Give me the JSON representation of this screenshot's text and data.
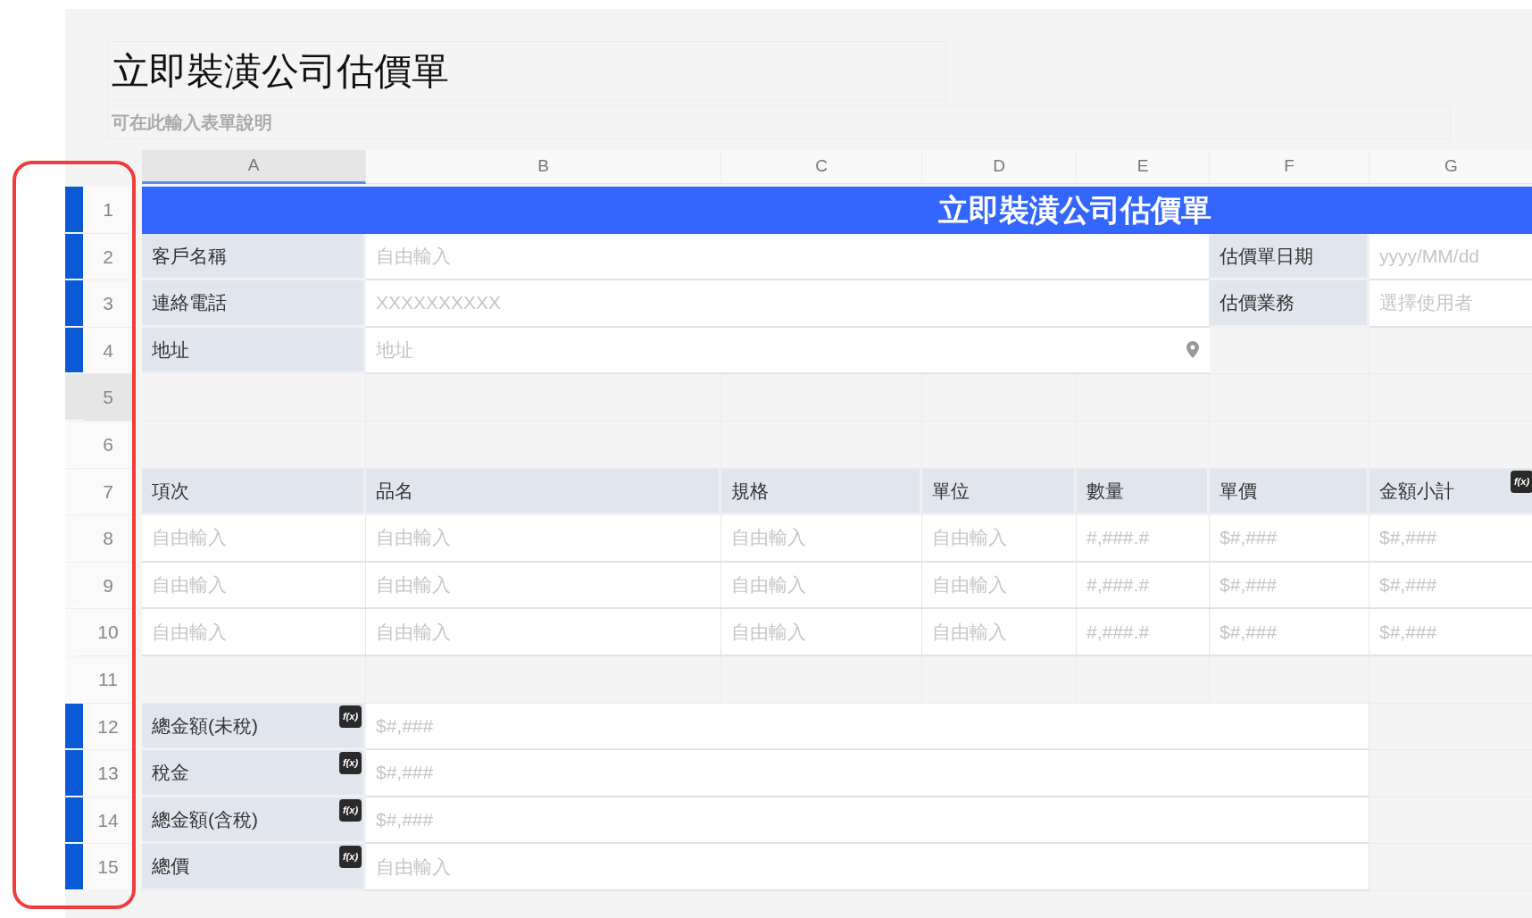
{
  "form_title": "立即裝潢公司估價單",
  "form_description": "可在此輸入表單說明",
  "row_header_highlight": true,
  "columns": [
    {
      "label": "A",
      "selected": true
    },
    {
      "label": "B",
      "selected": false
    },
    {
      "label": "C",
      "selected": false
    },
    {
      "label": "D",
      "selected": false
    },
    {
      "label": "E",
      "selected": false
    },
    {
      "label": "F",
      "selected": false
    },
    {
      "label": "G",
      "selected": false
    }
  ],
  "rows": [
    {
      "number": "1",
      "marked": true,
      "selected": false,
      "cells": [
        {
          "kind": "banner",
          "text": "立即裝潢公司估價單"
        },
        {
          "kind": "merged"
        },
        {
          "kind": "merged"
        },
        {
          "kind": "merged"
        },
        {
          "kind": "merged"
        },
        {
          "kind": "merged"
        },
        {
          "kind": "merged"
        }
      ]
    },
    {
      "number": "2",
      "marked": true,
      "selected": false,
      "cells": [
        {
          "kind": "label",
          "text": "客戶名稱"
        },
        {
          "kind": "input",
          "placeholder": "自由輸入"
        },
        {
          "kind": "merged"
        },
        {
          "kind": "merged"
        },
        {
          "kind": "merged"
        },
        {
          "kind": "label",
          "text": "估價單日期"
        },
        {
          "kind": "input",
          "placeholder": "yyyy/MM/dd"
        }
      ]
    },
    {
      "number": "3",
      "marked": true,
      "selected": false,
      "cells": [
        {
          "kind": "label",
          "text": "連絡電話"
        },
        {
          "kind": "input",
          "placeholder": "XXXXXXXXXX"
        },
        {
          "kind": "merged"
        },
        {
          "kind": "merged"
        },
        {
          "kind": "merged"
        },
        {
          "kind": "label",
          "text": "估價業務"
        },
        {
          "kind": "input",
          "placeholder": "選擇使用者"
        }
      ]
    },
    {
      "number": "4",
      "marked": true,
      "selected": false,
      "cells": [
        {
          "kind": "label",
          "text": "地址"
        },
        {
          "kind": "address",
          "placeholder": "地址"
        },
        {
          "kind": "merged"
        },
        {
          "kind": "merged"
        },
        {
          "kind": "merged"
        },
        {
          "kind": "blank"
        },
        {
          "kind": "blank"
        }
      ]
    },
    {
      "number": "5",
      "marked": false,
      "selected": true,
      "cells": [
        {
          "kind": "blank"
        },
        {
          "kind": "blank"
        },
        {
          "kind": "blank"
        },
        {
          "kind": "blank"
        },
        {
          "kind": "blank"
        },
        {
          "kind": "blank"
        },
        {
          "kind": "blank"
        }
      ]
    },
    {
      "number": "6",
      "marked": false,
      "selected": false,
      "cells": [
        {
          "kind": "blank"
        },
        {
          "kind": "blank"
        },
        {
          "kind": "blank"
        },
        {
          "kind": "blank"
        },
        {
          "kind": "blank"
        },
        {
          "kind": "blank"
        },
        {
          "kind": "blank"
        }
      ]
    },
    {
      "number": "7",
      "marked": false,
      "selected": false,
      "cells": [
        {
          "kind": "label",
          "text": "項次"
        },
        {
          "kind": "label",
          "text": "品名"
        },
        {
          "kind": "label",
          "text": "規格"
        },
        {
          "kind": "label",
          "text": "單位"
        },
        {
          "kind": "label",
          "text": "數量"
        },
        {
          "kind": "label",
          "text": "單價"
        },
        {
          "kind": "label",
          "text": "金額小計",
          "formula": "f(x)"
        }
      ]
    },
    {
      "number": "8",
      "marked": false,
      "selected": false,
      "cells": [
        {
          "kind": "input",
          "placeholder": "自由輸入"
        },
        {
          "kind": "input",
          "placeholder": "自由輸入"
        },
        {
          "kind": "input",
          "placeholder": "自由輸入"
        },
        {
          "kind": "input",
          "placeholder": "自由輸入"
        },
        {
          "kind": "input",
          "placeholder": "#,###.#"
        },
        {
          "kind": "input",
          "placeholder": "$#,###"
        },
        {
          "kind": "input",
          "placeholder": "$#,###"
        }
      ]
    },
    {
      "number": "9",
      "marked": false,
      "selected": false,
      "cells": [
        {
          "kind": "input",
          "placeholder": "自由輸入"
        },
        {
          "kind": "input",
          "placeholder": "自由輸入"
        },
        {
          "kind": "input",
          "placeholder": "自由輸入"
        },
        {
          "kind": "input",
          "placeholder": "自由輸入"
        },
        {
          "kind": "input",
          "placeholder": "#,###.#"
        },
        {
          "kind": "input",
          "placeholder": "$#,###"
        },
        {
          "kind": "input",
          "placeholder": "$#,###"
        }
      ]
    },
    {
      "number": "10",
      "marked": false,
      "selected": false,
      "cells": [
        {
          "kind": "input",
          "placeholder": "自由輸入"
        },
        {
          "kind": "input",
          "placeholder": "自由輸入"
        },
        {
          "kind": "input",
          "placeholder": "自由輸入"
        },
        {
          "kind": "input",
          "placeholder": "自由輸入"
        },
        {
          "kind": "input",
          "placeholder": "#,###.#"
        },
        {
          "kind": "input",
          "placeholder": "$#,###"
        },
        {
          "kind": "input",
          "placeholder": "$#,###"
        }
      ]
    },
    {
      "number": "11",
      "marked": false,
      "selected": false,
      "cells": [
        {
          "kind": "blank"
        },
        {
          "kind": "blank"
        },
        {
          "kind": "blank"
        },
        {
          "kind": "blank"
        },
        {
          "kind": "blank"
        },
        {
          "kind": "blank"
        },
        {
          "kind": "blank"
        }
      ]
    },
    {
      "number": "12",
      "marked": true,
      "selected": false,
      "cells": [
        {
          "kind": "label",
          "text": "總金額(未稅)",
          "formula": "f(x)"
        },
        {
          "kind": "input",
          "placeholder": "$#,###"
        },
        {
          "kind": "merged"
        },
        {
          "kind": "merged"
        },
        {
          "kind": "merged"
        },
        {
          "kind": "merged"
        },
        {
          "kind": "blank"
        }
      ]
    },
    {
      "number": "13",
      "marked": true,
      "selected": false,
      "cells": [
        {
          "kind": "label",
          "text": "稅金",
          "formula": "f(x)"
        },
        {
          "kind": "input",
          "placeholder": "$#,###"
        },
        {
          "kind": "merged"
        },
        {
          "kind": "merged"
        },
        {
          "kind": "merged"
        },
        {
          "kind": "merged"
        },
        {
          "kind": "blank"
        }
      ]
    },
    {
      "number": "14",
      "marked": true,
      "selected": false,
      "cells": [
        {
          "kind": "label",
          "text": "總金額(含稅)",
          "formula": "f(x)"
        },
        {
          "kind": "input",
          "placeholder": "$#,###"
        },
        {
          "kind": "merged"
        },
        {
          "kind": "merged"
        },
        {
          "kind": "merged"
        },
        {
          "kind": "merged"
        },
        {
          "kind": "blank"
        }
      ]
    },
    {
      "number": "15",
      "marked": true,
      "selected": false,
      "cells": [
        {
          "kind": "label",
          "text": "總價",
          "formula": "f(x)"
        },
        {
          "kind": "input",
          "placeholder": "自由輸入"
        },
        {
          "kind": "merged"
        },
        {
          "kind": "merged"
        },
        {
          "kind": "merged"
        },
        {
          "kind": "merged"
        },
        {
          "kind": "blank"
        }
      ]
    }
  ]
}
